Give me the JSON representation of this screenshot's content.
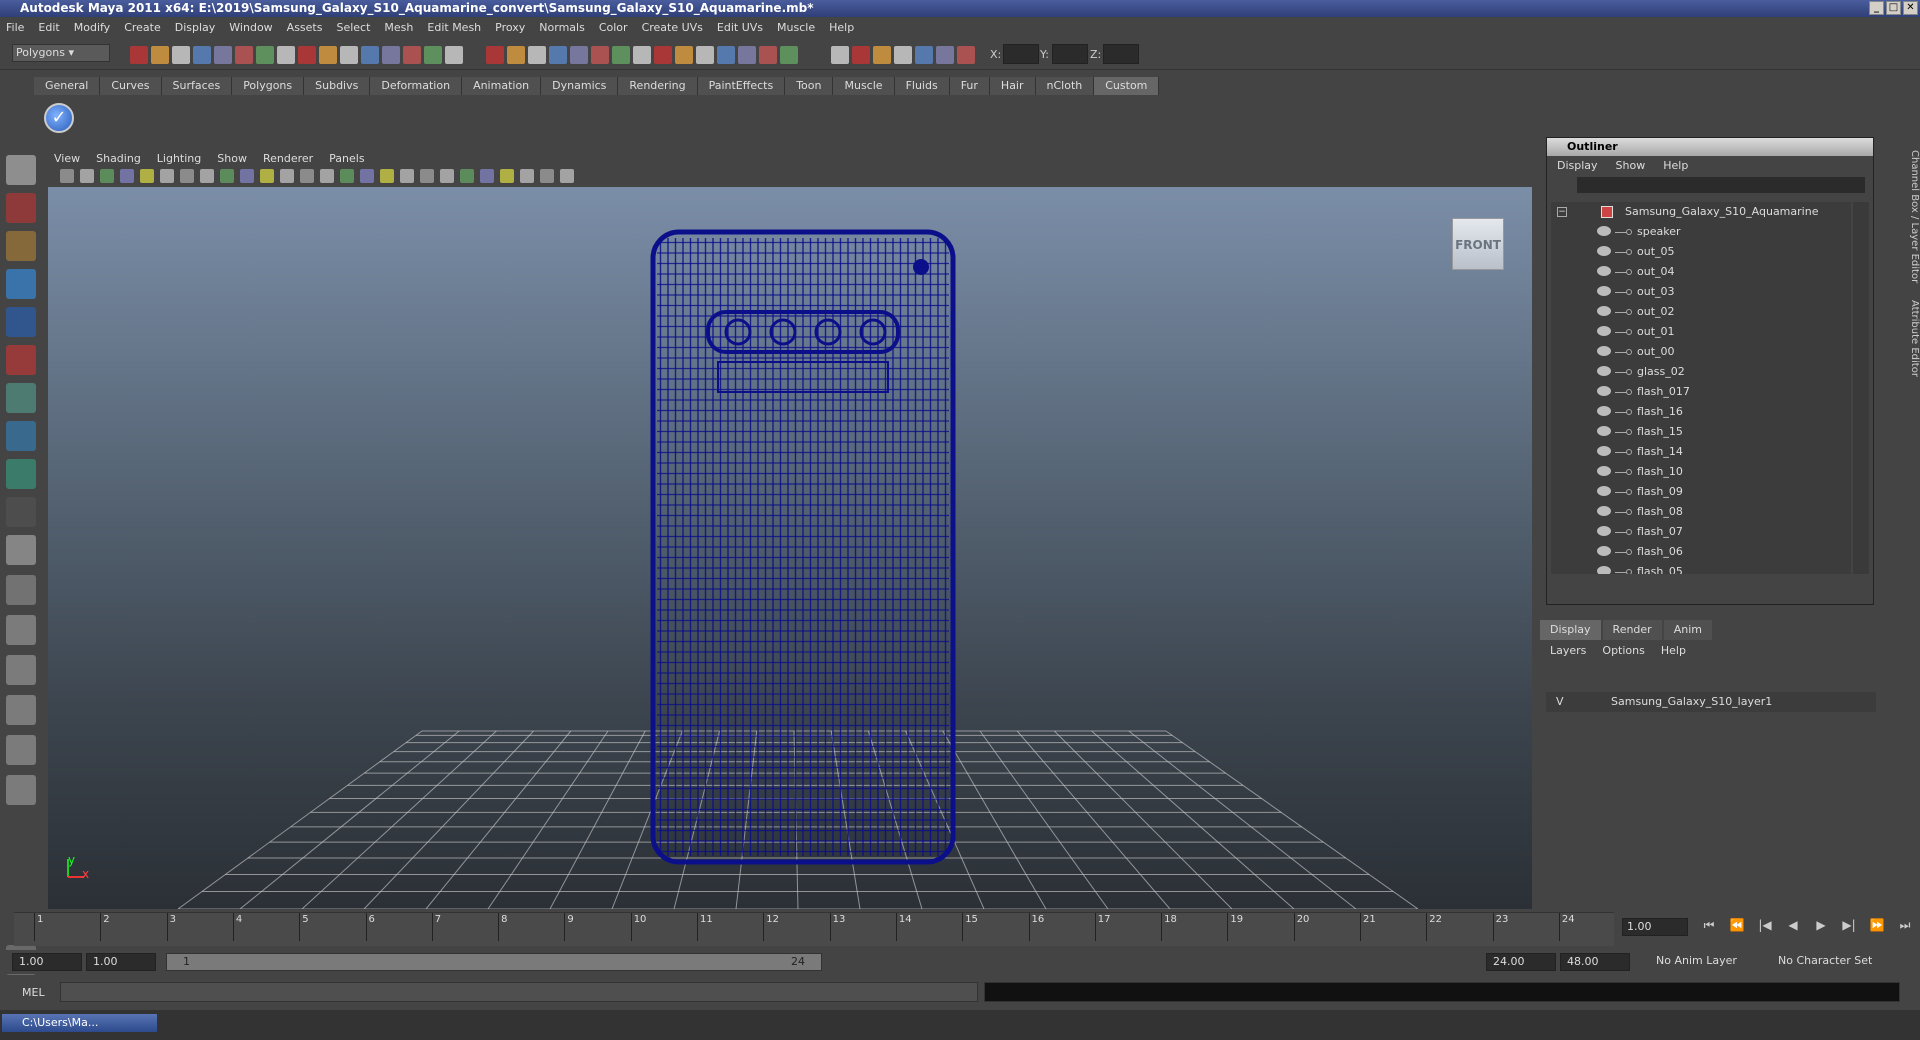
{
  "window": {
    "title": "Autodesk Maya 2011 x64: E:\\2019\\Samsung_Galaxy_S10_Aquamarine_convert\\Samsung_Galaxy_S10_Aquamarine.mb*"
  },
  "menus": [
    "File",
    "Edit",
    "Modify",
    "Create",
    "Display",
    "Window",
    "Assets",
    "Select",
    "Mesh",
    "Edit Mesh",
    "Proxy",
    "Normals",
    "Color",
    "Create UVs",
    "Edit UVs",
    "Muscle",
    "Help"
  ],
  "mode_selector": "Polygons",
  "coords": {
    "x": "X:",
    "y": "Y:",
    "z": "Z:"
  },
  "shelf_tabs": [
    "General",
    "Curves",
    "Surfaces",
    "Polygons",
    "Subdivs",
    "Deformation",
    "Animation",
    "Dynamics",
    "Rendering",
    "PaintEffects",
    "Toon",
    "Muscle",
    "Fluids",
    "Fur",
    "Hair",
    "nCloth",
    "Custom"
  ],
  "shelf_active": "Custom",
  "viewport": {
    "menus": [
      "View",
      "Shading",
      "Lighting",
      "Show",
      "Renderer",
      "Panels"
    ],
    "view_cube_label": "FRONT",
    "axis_y": "y",
    "axis_x": "x"
  },
  "outliner": {
    "title": "Outliner",
    "menus": [
      "Display",
      "Show",
      "Help"
    ],
    "root": "Samsung_Galaxy_S10_Aquamarine",
    "items": [
      "speaker",
      "out_05",
      "out_04",
      "out_03",
      "out_02",
      "out_01",
      "out_00",
      "glass_02",
      "flash_017",
      "flash_16",
      "flash_15",
      "flash_14",
      "flash_10",
      "flash_09",
      "flash_08",
      "flash_07",
      "flash_06",
      "flash_05"
    ]
  },
  "layers": {
    "tabs": [
      "Display",
      "Render",
      "Anim"
    ],
    "active_tab": "Display",
    "menus": [
      "Layers",
      "Options",
      "Help"
    ],
    "layer_visibility": "V",
    "layer_name": "Samsung_Galaxy_S10_layer1"
  },
  "side_tabs": "Channel Box / Layer Editor",
  "side_tabs2": "Attribute Editor",
  "timeline": {
    "ticks": [
      "1",
      "2",
      "3",
      "4",
      "5",
      "6",
      "7",
      "8",
      "9",
      "10",
      "11",
      "12",
      "13",
      "14",
      "15",
      "16",
      "17",
      "18",
      "19",
      "20",
      "21",
      "22",
      "23",
      "24"
    ],
    "current_frame": "1.00"
  },
  "range": {
    "start": "1.00",
    "start2": "1.00",
    "slider_start": "1",
    "slider_end": "24",
    "end": "24.00",
    "end2": "48.00",
    "anim_layer": "No Anim Layer",
    "char_set": "No Character Set"
  },
  "mel": {
    "label": "MEL"
  },
  "taskbar": {
    "item": "C:\\Users\\Ma..."
  },
  "colors": {
    "wire": "#0b0f8a",
    "grid": "#c8c8c8",
    "viewport_top": "#7b8ea8",
    "viewport_bottom": "#2b3036"
  }
}
